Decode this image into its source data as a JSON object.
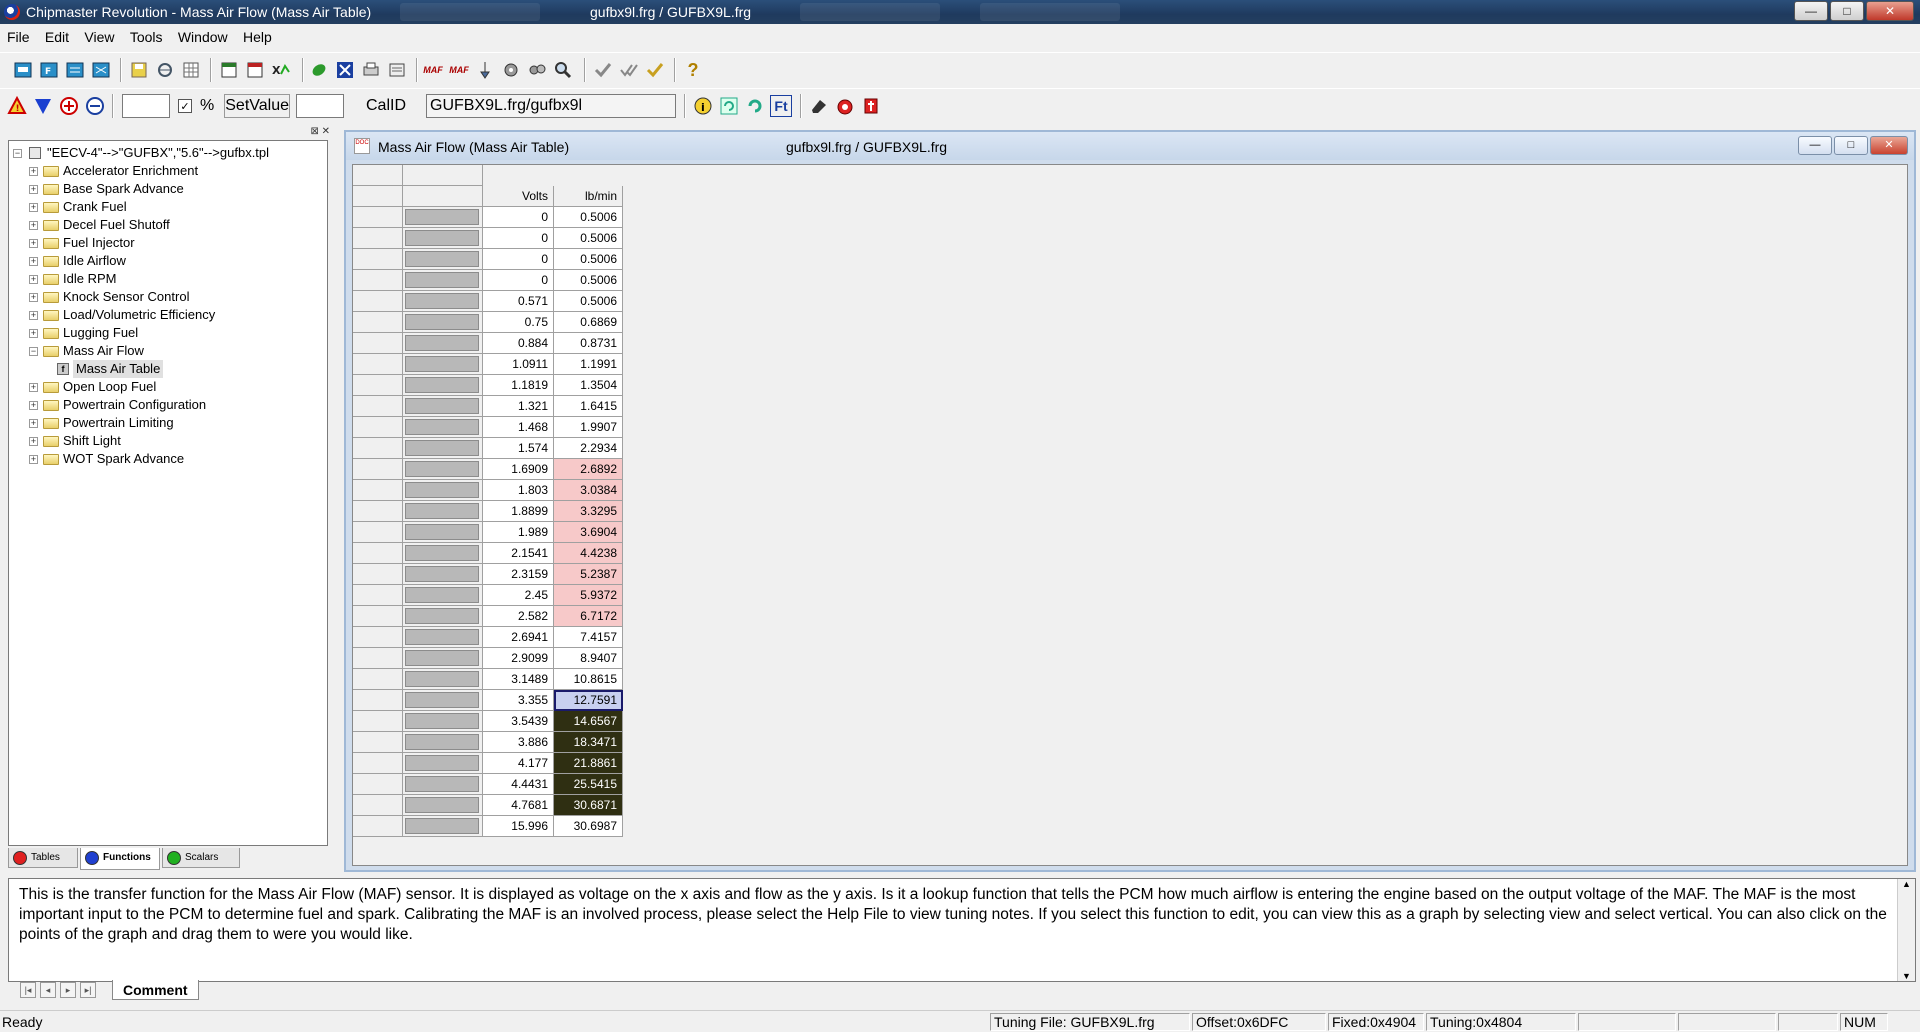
{
  "window": {
    "title": "Chipmaster Revolution - Mass Air Flow  (Mass Air Table)",
    "file_info": "gufbx9l.frg  /  GUFBX9L.frg",
    "min_label": "—",
    "max_label": "□",
    "close_label": "✕"
  },
  "menu": {
    "items": [
      "File",
      "Edit",
      "View",
      "Tools",
      "Window",
      "Help"
    ]
  },
  "toolbar2": {
    "pct_check": "✓",
    "pct_label": "%",
    "set_value": "SetValue",
    "callid_label": "CalID",
    "callid_value": "GUFBX9L.frg/gufbx9l"
  },
  "tree": {
    "root": "\"EECV-4\"-->\"GUFBX\",\"5.6\"-->gufbx.tpl",
    "folders": [
      "Accelerator Enrichment",
      "Base Spark Advance",
      "Crank Fuel",
      "Decel Fuel Shutoff",
      "Fuel Injector",
      "Idle Airflow",
      "Idle RPM",
      "Knock Sensor Control",
      "Load/Volumetric Efficiency",
      "Lugging Fuel",
      "Mass Air Flow",
      "Open Loop Fuel",
      "Powertrain Configuration",
      "Powertrain Limiting",
      "Shift Light",
      "WOT Spark Advance"
    ],
    "child_item": "Mass Air Table",
    "tabs": [
      "Tables",
      "Functions",
      "Scalars"
    ],
    "tab_colors": [
      "#e02020",
      "#2040d0",
      "#20b020"
    ]
  },
  "child_window": {
    "title": "Mass Air Flow  (Mass Air Table)",
    "file_info": "gufbx9l.frg  /  GUFBX9L.frg"
  },
  "table": {
    "headers": [
      "Volts",
      "lb/min"
    ],
    "rows": [
      [
        "0",
        "0.5006"
      ],
      [
        "0",
        "0.5006"
      ],
      [
        "0",
        "0.5006"
      ],
      [
        "0",
        "0.5006"
      ],
      [
        "0.571",
        "0.5006"
      ],
      [
        "0.75",
        "0.6869"
      ],
      [
        "0.884",
        "0.8731"
      ],
      [
        "1.0911",
        "1.1991"
      ],
      [
        "1.1819",
        "1.3504"
      ],
      [
        "1.321",
        "1.6415"
      ],
      [
        "1.468",
        "1.9907"
      ],
      [
        "1.574",
        "2.2934"
      ],
      [
        "1.6909",
        "2.6892"
      ],
      [
        "1.803",
        "3.0384"
      ],
      [
        "1.8899",
        "3.3295"
      ],
      [
        "1.989",
        "3.6904"
      ],
      [
        "2.1541",
        "4.4238"
      ],
      [
        "2.3159",
        "5.2387"
      ],
      [
        "2.45",
        "5.9372"
      ],
      [
        "2.582",
        "6.7172"
      ],
      [
        "2.6941",
        "7.4157"
      ],
      [
        "2.9099",
        "8.9407"
      ],
      [
        "3.1489",
        "10.8615"
      ],
      [
        "3.355",
        "12.7591"
      ],
      [
        "3.5439",
        "14.6567"
      ],
      [
        "3.886",
        "18.3471"
      ],
      [
        "4.177",
        "21.8861"
      ],
      [
        "4.4431",
        "25.5415"
      ],
      [
        "4.7681",
        "30.6871"
      ],
      [
        "15.996",
        "30.6987"
      ]
    ],
    "row_styles": [
      "",
      "",
      "",
      "",
      "",
      "",
      "",
      "",
      "",
      "",
      "",
      "",
      "pink",
      "pink",
      "pink",
      "pink",
      "pink",
      "pink",
      "pink",
      "pink",
      "",
      "",
      "",
      "selected",
      "dark",
      "dark",
      "dark",
      "dark",
      "dark",
      ""
    ],
    "highlight_colors": {
      "pink": "#f7c9c9",
      "dark": "#2f2f12",
      "selected": "#c8d0f0"
    }
  },
  "comment": {
    "text": "This is the transfer function for the Mass Air Flow (MAF) sensor. It is displayed as voltage on the x axis and flow as the y axis.  Is it a lookup function that tells the PCM how much airflow is entering the engine based on the output voltage of the MAF. The MAF is the most important input to the PCM to determine fuel and spark. Calibrating the MAF is an involved process, please select the Help File to  view tuning notes. If you select this function to edit, you can view this as a graph by selecting view and select vertical. You can also click on the points of the graph and drag them to were you would like.",
    "tab": "Comment"
  },
  "status": {
    "ready": "Ready",
    "tuning_file": "Tuning File: GUFBX9L.frg",
    "offset": "Offset:0x6DFC",
    "fixed": "Fixed:0x4904",
    "tuning": "Tuning:0x4804",
    "num": "NUM"
  }
}
